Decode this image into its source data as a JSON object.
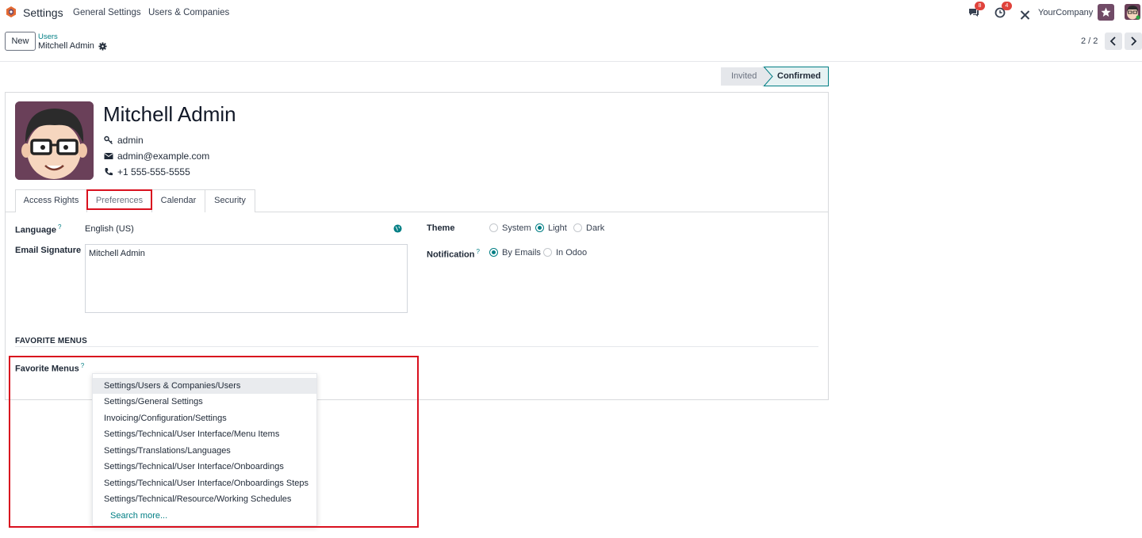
{
  "navbar": {
    "app_name": "Settings",
    "menu": [
      "General Settings",
      "Users & Companies"
    ],
    "messages_badge": "8",
    "activities_badge": "4",
    "company": "YourCompany"
  },
  "control_panel": {
    "new_label": "New",
    "breadcrumb_parent": "Users",
    "breadcrumb_current": "Mitchell Admin",
    "pager": "2 / 2"
  },
  "status": {
    "invited": "Invited",
    "confirmed": "Confirmed",
    "active": "Confirmed"
  },
  "user": {
    "name": "Mitchell Admin",
    "login": "admin",
    "email": "admin@example.com",
    "phone": "+1 555-555-5555"
  },
  "tabs": [
    "Access Rights",
    "Preferences",
    "Calendar",
    "Security"
  ],
  "active_tab": "Preferences",
  "preferences": {
    "language_label": "Language",
    "language_value": "English (US)",
    "signature_label": "Email Signature",
    "signature_value": "Mitchell Admin",
    "theme_label": "Theme",
    "theme_options": [
      "System",
      "Light",
      "Dark"
    ],
    "theme_selected": "Light",
    "notification_label": "Notification",
    "notification_options": [
      "By Emails",
      "In Odoo"
    ],
    "notification_selected": "By Emails",
    "help_mark": "?"
  },
  "favorites": {
    "section_title": "FAVORITE MENUS",
    "field_label": "Favorite Menus",
    "dropdown_items": [
      "Settings/Users & Companies/Users",
      "Settings/General Settings",
      "Invoicing/Configuration/Settings",
      "Settings/Technical/User Interface/Menu Items",
      "Settings/Translations/Languages",
      "Settings/Technical/User Interface/Onboardings",
      "Settings/Technical/User Interface/Onboardings Steps",
      "Settings/Technical/Resource/Working Schedules"
    ],
    "search_more": "Search more..."
  },
  "colors": {
    "accent": "#017e84",
    "brand": "#714b67",
    "highlight": "#d9101e"
  }
}
